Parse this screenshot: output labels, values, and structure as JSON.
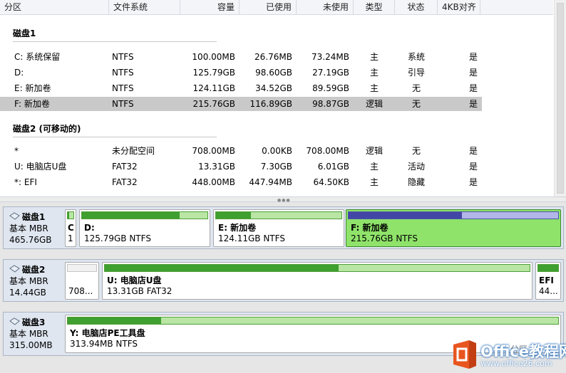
{
  "columns": [
    "分区",
    "文件系统",
    "容量",
    "已使用",
    "未使用",
    "类型",
    "状态",
    "4KB对齐"
  ],
  "groups": [
    {
      "name": "磁盘1",
      "rows": [
        {
          "partition": "C: 系统保留",
          "fs": "NTFS",
          "capacity": "100.00MB",
          "used": "26.76MB",
          "free": "73.24MB",
          "type": "主",
          "status": "系统",
          "align": "是"
        },
        {
          "partition": "D:",
          "fs": "NTFS",
          "capacity": "125.79GB",
          "used": "98.60GB",
          "free": "27.19GB",
          "type": "主",
          "status": "引导",
          "align": "是"
        },
        {
          "partition": "E: 新加卷",
          "fs": "NTFS",
          "capacity": "124.11GB",
          "used": "34.52GB",
          "free": "89.59GB",
          "type": "主",
          "status": "无",
          "align": "是"
        },
        {
          "partition": "F: 新加卷",
          "fs": "NTFS",
          "capacity": "215.76GB",
          "used": "116.89GB",
          "free": "98.87GB",
          "type": "逻辑",
          "status": "无",
          "align": "是",
          "selected": true
        }
      ]
    },
    {
      "name": "磁盘2 (可移动的)",
      "rows": [
        {
          "partition": "*",
          "fs": "未分配空间",
          "capacity": "708.00MB",
          "used": "0.00KB",
          "free": "708.00MB",
          "type": "逻辑",
          "status": "无",
          "align": "是"
        },
        {
          "partition": "U: 电脑店U盘",
          "fs": "FAT32",
          "capacity": "13.31GB",
          "used": "7.30GB",
          "free": "6.01GB",
          "type": "主",
          "status": "活动",
          "align": "是"
        },
        {
          "partition": "*: EFI",
          "fs": "FAT32",
          "capacity": "448.00MB",
          "used": "447.94MB",
          "free": "64.50KB",
          "type": "主",
          "status": "隐藏",
          "align": "是"
        }
      ]
    }
  ],
  "disks": [
    {
      "name": "磁盘1",
      "kind": "基本 MBR",
      "size": "465.76GB",
      "parts": [
        {
          "name": "C",
          "detail": "1",
          "usage": 0.27,
          "style": "green"
        },
        {
          "name": "D:",
          "detail": "125.79GB NTFS",
          "usage": 0.78,
          "style": "green"
        },
        {
          "name": "E: 新加卷",
          "detail": "124.11GB NTFS",
          "usage": 0.28,
          "style": "green"
        },
        {
          "name": "F: 新加卷",
          "detail": "215.76GB NTFS",
          "usage": 0.54,
          "style": "blue",
          "selected": true
        }
      ]
    },
    {
      "name": "磁盘2",
      "kind": "基本 MBR",
      "size": "14.44GB",
      "parts": [
        {
          "name": "",
          "detail": "708...",
          "usage": 0,
          "style": "gray"
        },
        {
          "name": "U: 电脑店U盘",
          "detail": "13.31GB FAT32",
          "usage": 0.55,
          "style": "green"
        },
        {
          "name": "EFI",
          "detail": "44...",
          "usage": 1,
          "style": "green"
        }
      ]
    },
    {
      "name": "磁盘3",
      "kind": "基本 MBR",
      "size": "315.00MB",
      "parts": [
        {
          "name": "Y: 电脑店PE工具盘",
          "detail": "313.94MB NTFS",
          "usage": 0.19,
          "style": "green"
        }
      ]
    }
  ],
  "watermark": {
    "brand": "Office教程网",
    "url": "www.office26.com",
    "faint": "分区"
  },
  "colors": {
    "used_green": "#3fa02f",
    "free_green": "#b9e6a4",
    "used_blue": "#4247a6",
    "free_blue": "#b2b6e8",
    "selected_part": "#8fe36a",
    "selected_row": "#c9c9c9"
  }
}
